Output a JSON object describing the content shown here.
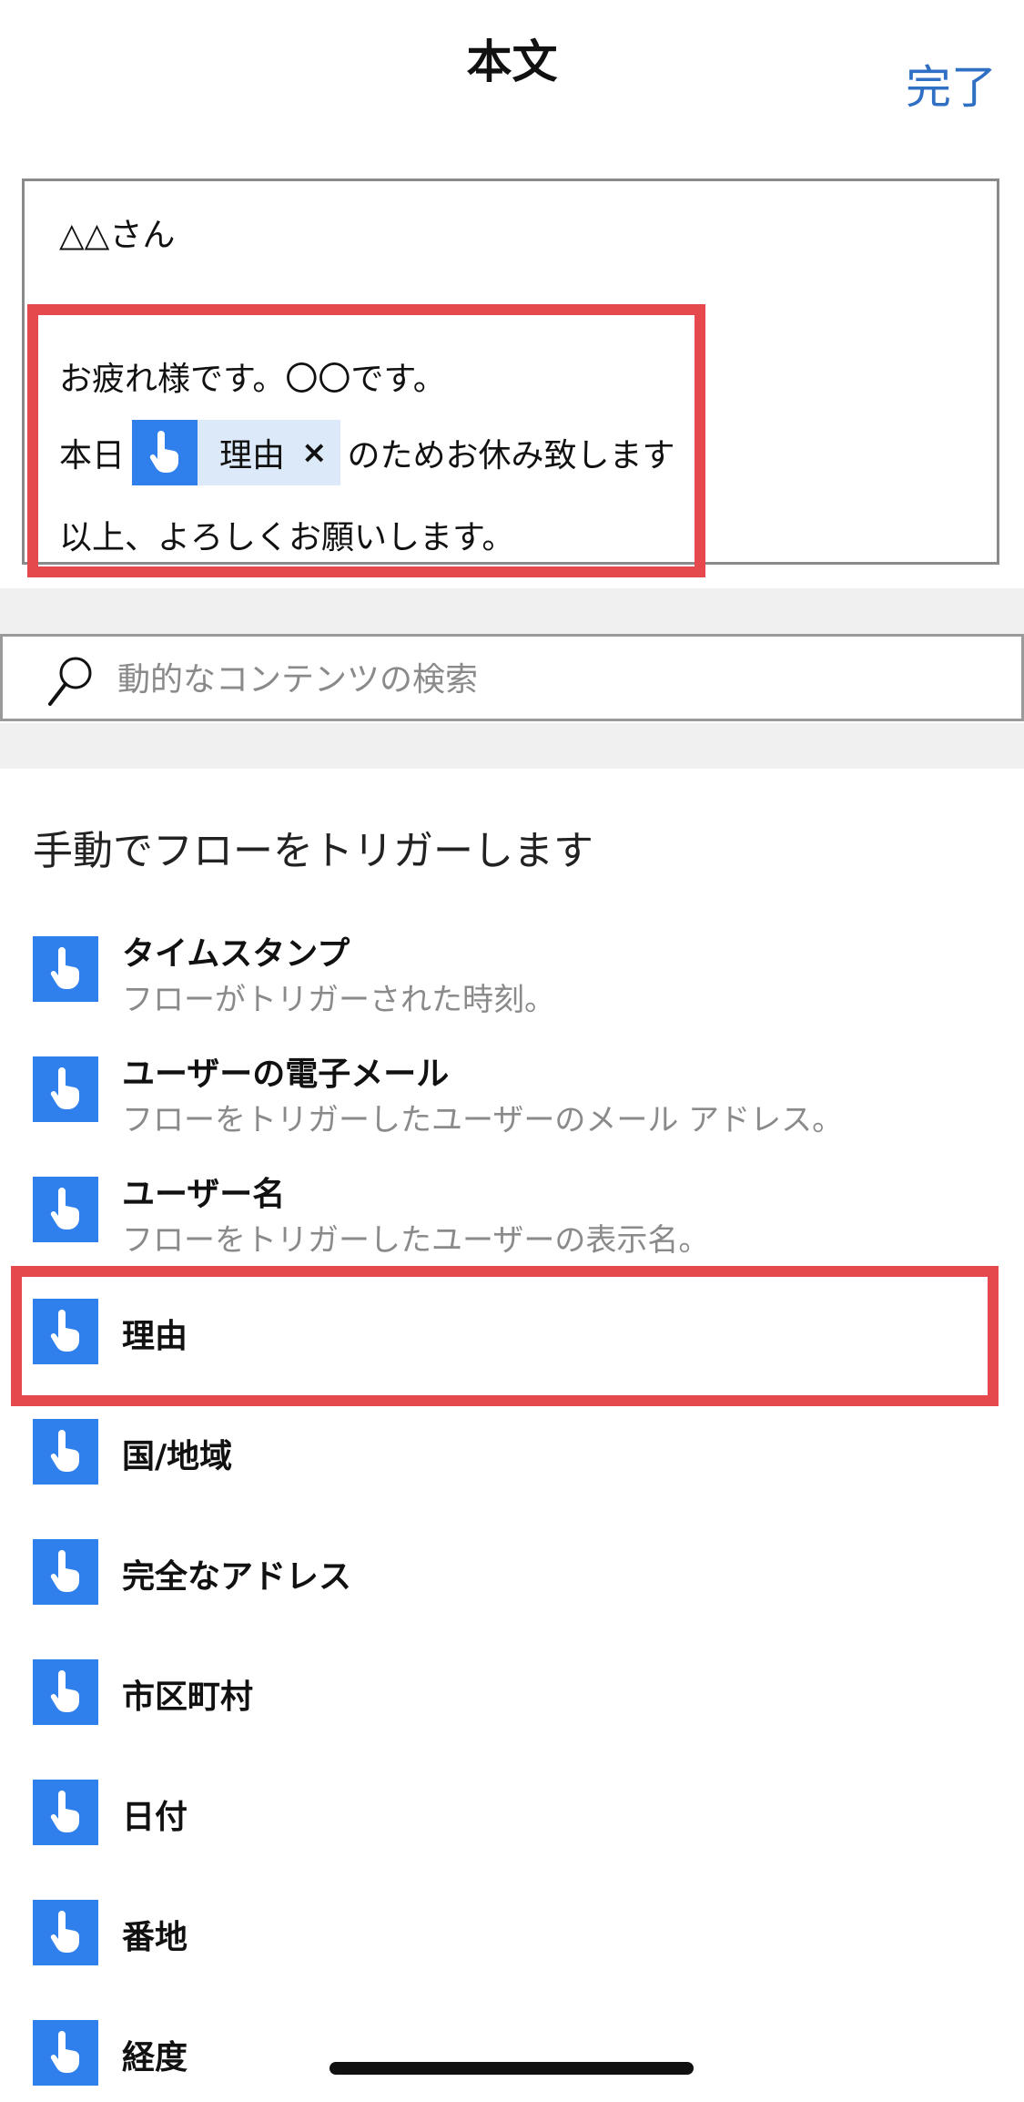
{
  "header": {
    "title": "本文",
    "done_label": "完了"
  },
  "editor": {
    "line1": "△△さん",
    "line2": "お疲れ様です。〇〇です。",
    "line3_prefix": "本日",
    "token_label": "理由",
    "token_close": "×",
    "line3_suffix": "のためお休み致します",
    "line4": "以上、よろしくお願いします。"
  },
  "search": {
    "placeholder": "動的なコンテンツの検索"
  },
  "section": {
    "title": "手動でフローをトリガーします"
  },
  "items": [
    {
      "title": "タイムスタンプ",
      "desc": "フローがトリガーされた時刻。"
    },
    {
      "title": "ユーザーの電子メール",
      "desc": "フローをトリガーしたユーザーのメール アドレス。"
    },
    {
      "title": "ユーザー名",
      "desc": "フローをトリガーしたユーザーの表示名。"
    },
    {
      "title": "理由"
    },
    {
      "title": "国/地域"
    },
    {
      "title": "完全なアドレス"
    },
    {
      "title": "市区町村"
    },
    {
      "title": "日付"
    },
    {
      "title": "番地"
    },
    {
      "title": "経度"
    }
  ],
  "colors": {
    "accent": "#2f6fc4",
    "icon_bg": "#2f80ed",
    "token_bg": "#dbe9f8",
    "highlight": "#e5484d"
  },
  "icons": {
    "item_icon": "hand-pointer-icon",
    "search": "search-icon"
  }
}
